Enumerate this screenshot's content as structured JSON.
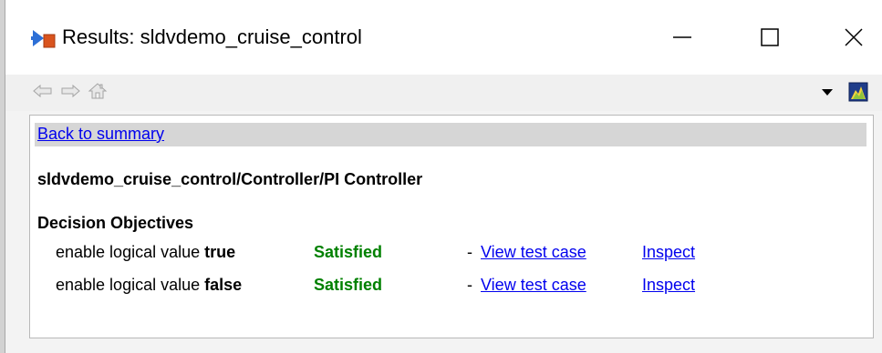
{
  "window": {
    "title": "Results: sldvdemo_cruise_control",
    "minimize_symbol": "—",
    "close_symbol": "✕",
    "icons": [
      "simulink-model-icon",
      "minimize-icon",
      "maximize-icon",
      "close-icon"
    ]
  },
  "toolbar": {
    "icons": [
      "back-arrow-icon",
      "forward-arrow-icon",
      "home-icon",
      "dropdown-arrow-icon",
      "help-icon"
    ]
  },
  "content": {
    "back_link": "Back to summary",
    "model_path": "sldvdemo_cruise_control/Controller/PI Controller",
    "section_heading": "Decision Objectives",
    "objectives": [
      {
        "desc_prefix": "enable logical value ",
        "desc_value": "true",
        "status": "Satisfied",
        "dash": "-",
        "view_link": "View test case",
        "inspect_link": "Inspect"
      },
      {
        "desc_prefix": "enable logical value ",
        "desc_value": "false",
        "status": "Satisfied",
        "dash": "-",
        "view_link": "View test case",
        "inspect_link": "Inspect"
      }
    ]
  },
  "colors": {
    "link": "#0000ee",
    "satisfied": "#008000",
    "back_bar": "#d6d6d6"
  }
}
